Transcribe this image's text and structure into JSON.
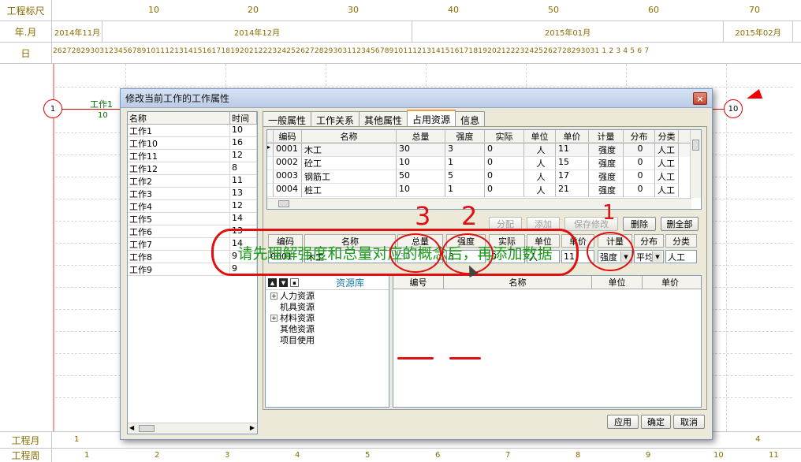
{
  "ruler": {
    "label_row1": "工程标尺",
    "label_row2": "年.月",
    "label_row3": "日",
    "scale_ticks": [
      "10",
      "20",
      "30",
      "40",
      "50",
      "60",
      "70"
    ],
    "months": [
      "2014年11月",
      "2014年12月",
      "2015年01月",
      "2015年02月"
    ],
    "days": "262728293031234567891011121314151617181920212223242526272829303112345678910111213141516171819202122232425262728293031 1 2 3 4 5 6 7"
  },
  "network": {
    "start_node": "1",
    "end_node": "10",
    "work_name": "工作1",
    "work_duration": "10"
  },
  "bottom": {
    "row1_label": "工程月",
    "row1_values": [
      "1",
      "4"
    ],
    "row2_label": "工程周",
    "row2_values": [
      "1",
      "2",
      "3",
      "4",
      "5",
      "6",
      "7",
      "8",
      "9",
      "10",
      "11"
    ]
  },
  "dialog": {
    "title": "修改当前工作的工作属性",
    "close": "×",
    "task_list": {
      "headers": [
        "名称",
        "时间"
      ],
      "rows": [
        [
          "工作1",
          "10"
        ],
        [
          "工作10",
          "16"
        ],
        [
          "工作11",
          "12"
        ],
        [
          "工作12",
          "8"
        ],
        [
          "工作2",
          "11"
        ],
        [
          "工作3",
          "13"
        ],
        [
          "工作4",
          "12"
        ],
        [
          "工作5",
          "14"
        ],
        [
          "工作6",
          "13"
        ],
        [
          "工作7",
          "14"
        ],
        [
          "工作8",
          "9"
        ],
        [
          "工作9",
          "9"
        ]
      ]
    },
    "tabs": [
      "一般属性",
      "工作关系",
      "其他属性",
      "占用资源",
      "信息"
    ],
    "active_tab": 3,
    "resource_grid": {
      "headers": [
        "编码",
        "名称",
        "总量",
        "强度",
        "实际",
        "单位",
        "单价",
        "计量",
        "分布",
        "分类"
      ],
      "rows": [
        [
          "0001",
          "木工",
          "30",
          "3",
          "0",
          "人",
          "11",
          "强度",
          "0",
          "人工"
        ],
        [
          "0002",
          "砼工",
          "10",
          "1",
          "0",
          "人",
          "15",
          "强度",
          "0",
          "人工"
        ],
        [
          "0003",
          "钢筋工",
          "50",
          "5",
          "0",
          "人",
          "17",
          "强度",
          "0",
          "人工"
        ],
        [
          "0004",
          "桩工",
          "10",
          "1",
          "0",
          "人",
          "21",
          "强度",
          "0",
          "人工"
        ]
      ]
    },
    "buttons": {
      "allocate": "分配",
      "add": "添加",
      "save_edit": "保存修改",
      "delete": "删除",
      "delete_all": "删全部",
      "apply": "应用",
      "ok": "确定",
      "cancel": "取消"
    },
    "editor": {
      "headers": [
        "编码",
        "名称",
        "总量",
        "强度",
        "实际",
        "单位",
        "单价",
        "计量",
        "分布",
        "分类"
      ],
      "values": {
        "code": "0001",
        "name": "木工",
        "total": "30",
        "intensity": "3",
        "actual": "0",
        "unit": "人",
        "price": "11",
        "measure": "强度",
        "distribution": "平均",
        "category": "人工"
      }
    },
    "library": {
      "title": "资源库",
      "tree": [
        {
          "label": "人力资源",
          "expandable": true
        },
        {
          "label": "机具资源",
          "expandable": false
        },
        {
          "label": "材料资源",
          "expandable": true
        },
        {
          "label": "其他资源",
          "expandable": false
        },
        {
          "label": "项目使用",
          "expandable": false
        }
      ],
      "grid_headers": [
        "编号",
        "名称",
        "单位",
        "单价"
      ]
    }
  },
  "annotation": {
    "text": "请先理解强度和总量对应的概念后，再添加数据",
    "mark_3": "3",
    "mark_2": "2",
    "mark_1": "1"
  },
  "colors": {
    "ruler_text": "#8a6d00",
    "annotation_red": "#e01010",
    "annotation_green": "#1a9a1a",
    "library_title": "#1a7aa8"
  }
}
